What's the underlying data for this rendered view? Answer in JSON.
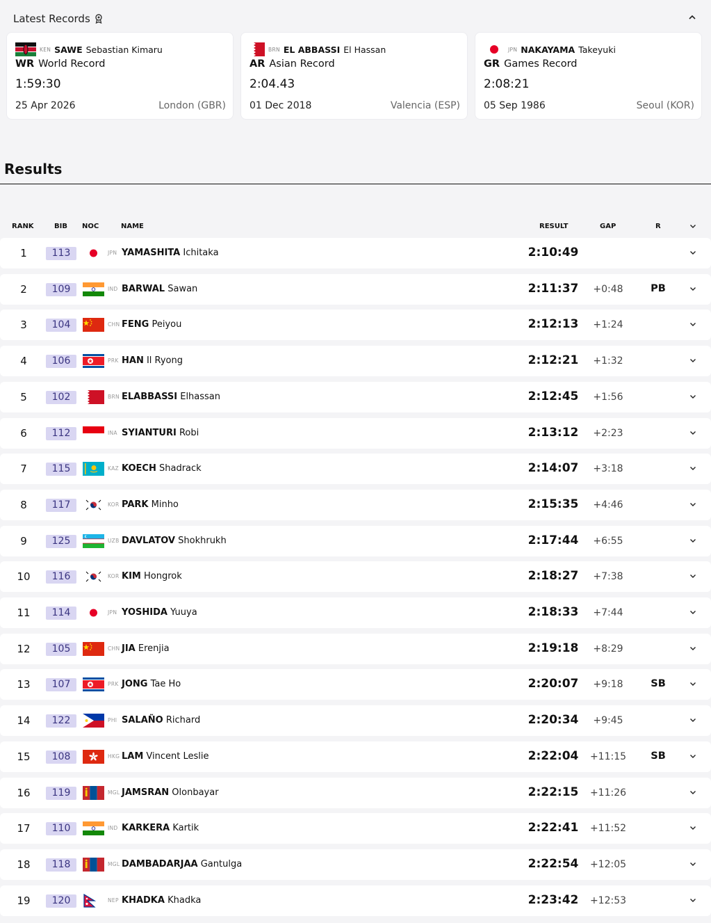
{
  "records": {
    "title": "Latest Records",
    "cards": [
      {
        "noc": "KEN",
        "surname": "SAWE",
        "given": "Sebastian Kimaru",
        "abbr": "WR",
        "type": "World Record",
        "time": "1:59:30",
        "date": "25 Apr 2026",
        "venue": "London (GBR)"
      },
      {
        "noc": "BRN",
        "surname": "EL ABBASSI",
        "given": "El Hassan",
        "abbr": "AR",
        "type": "Asian Record",
        "time": "2:04.43",
        "date": "01 Dec 2018",
        "venue": "Valencia (ESP)"
      },
      {
        "noc": "JPN",
        "surname": "NAKAYAMA",
        "given": "Takeyuki",
        "abbr": "GR",
        "type": "Games Record",
        "time": "2:08:21",
        "date": "05 Sep 1986",
        "venue": "Seoul (KOR)"
      }
    ]
  },
  "results": {
    "title": "Results",
    "headers": {
      "rank": "RANK",
      "bib": "BIB",
      "noc": "NOC",
      "name": "NAME",
      "result": "RESULT",
      "gap": "GAP",
      "record": "R"
    },
    "rows": [
      {
        "rank": "1",
        "bib": "113",
        "noc": "JPN",
        "surname": "YAMASHITA",
        "given": "Ichitaka",
        "result": "2:10:49",
        "gap": "",
        "record": ""
      },
      {
        "rank": "2",
        "bib": "109",
        "noc": "IND",
        "surname": "BARWAL",
        "given": "Sawan",
        "result": "2:11:37",
        "gap": "+0:48",
        "record": "PB"
      },
      {
        "rank": "3",
        "bib": "104",
        "noc": "CHN",
        "surname": "FENG",
        "given": "Peiyou",
        "result": "2:12:13",
        "gap": "+1:24",
        "record": ""
      },
      {
        "rank": "4",
        "bib": "106",
        "noc": "PRK",
        "surname": "HAN",
        "given": "Il Ryong",
        "result": "2:12:21",
        "gap": "+1:32",
        "record": ""
      },
      {
        "rank": "5",
        "bib": "102",
        "noc": "BRN",
        "surname": "ELABBASSI",
        "given": "Elhassan",
        "result": "2:12:45",
        "gap": "+1:56",
        "record": ""
      },
      {
        "rank": "6",
        "bib": "112",
        "noc": "INA",
        "surname": "SYIANTURI",
        "given": "Robi",
        "result": "2:13:12",
        "gap": "+2:23",
        "record": ""
      },
      {
        "rank": "7",
        "bib": "115",
        "noc": "KAZ",
        "surname": "KOECH",
        "given": "Shadrack",
        "result": "2:14:07",
        "gap": "+3:18",
        "record": ""
      },
      {
        "rank": "8",
        "bib": "117",
        "noc": "KOR",
        "surname": "PARK",
        "given": "Minho",
        "result": "2:15:35",
        "gap": "+4:46",
        "record": ""
      },
      {
        "rank": "9",
        "bib": "125",
        "noc": "UZB",
        "surname": "DAVLATOV",
        "given": "Shokhrukh",
        "result": "2:17:44",
        "gap": "+6:55",
        "record": ""
      },
      {
        "rank": "10",
        "bib": "116",
        "noc": "KOR",
        "surname": "KIM",
        "given": "Hongrok",
        "result": "2:18:27",
        "gap": "+7:38",
        "record": ""
      },
      {
        "rank": "11",
        "bib": "114",
        "noc": "JPN",
        "surname": "YOSHIDA",
        "given": "Yuuya",
        "result": "2:18:33",
        "gap": "+7:44",
        "record": ""
      },
      {
        "rank": "12",
        "bib": "105",
        "noc": "CHN",
        "surname": "JIA",
        "given": "Erenjia",
        "result": "2:19:18",
        "gap": "+8:29",
        "record": ""
      },
      {
        "rank": "13",
        "bib": "107",
        "noc": "PRK",
        "surname": "JONG",
        "given": "Tae Ho",
        "result": "2:20:07",
        "gap": "+9:18",
        "record": "SB"
      },
      {
        "rank": "14",
        "bib": "122",
        "noc": "PHI",
        "surname": "SALAÑO",
        "given": "Richard",
        "result": "2:20:34",
        "gap": "+9:45",
        "record": ""
      },
      {
        "rank": "15",
        "bib": "108",
        "noc": "HKG",
        "surname": "LAM",
        "given": "Vincent Leslie",
        "result": "2:22:04",
        "gap": "+11:15",
        "record": "SB"
      },
      {
        "rank": "16",
        "bib": "119",
        "noc": "MGL",
        "surname": "JAMSRAN",
        "given": "Olonbayar",
        "result": "2:22:15",
        "gap": "+11:26",
        "record": ""
      },
      {
        "rank": "17",
        "bib": "110",
        "noc": "IND",
        "surname": "KARKERA",
        "given": "Kartik",
        "result": "2:22:41",
        "gap": "+11:52",
        "record": ""
      },
      {
        "rank": "18",
        "bib": "118",
        "noc": "MGL",
        "surname": "DAMBADARJAA",
        "given": "Gantulga",
        "result": "2:22:54",
        "gap": "+12:05",
        "record": ""
      },
      {
        "rank": "19",
        "bib": "120",
        "noc": "NEP",
        "surname": "KHADKA",
        "given": "Khadka",
        "result": "2:23:42",
        "gap": "+12:53",
        "record": ""
      }
    ]
  }
}
